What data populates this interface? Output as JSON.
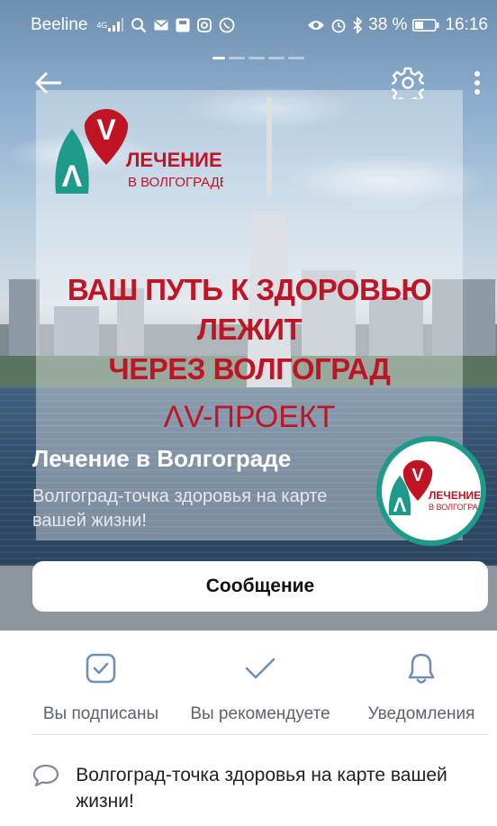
{
  "status_bar": {
    "carrier": "Beeline",
    "network": "4G",
    "battery": "38 %",
    "time": "16:16"
  },
  "pager": {
    "pages": 5,
    "active": 1
  },
  "nav": {
    "back_icon": "arrow-left-icon",
    "settings_icon": "gear-icon",
    "more_icon": "more-vertical-icon"
  },
  "cover": {
    "logo_text_line1": "ЛЕЧЕНИЕ",
    "logo_text_line2": "В ВОЛГОГРАДЕ",
    "headline_lines": [
      "ВАШ ПУТЬ К ЗДОРОВЬЮ",
      "ЛЕЖИТ",
      "ЧЕРЕЗ ВОЛГОГРАД"
    ],
    "subline": "ΛV-ПРОЕКТ"
  },
  "group": {
    "name": "Лечение в Волгограде",
    "status": "Волгоград-точка здоровья на карте вашей жизни!"
  },
  "avatar": {
    "line1": "ЛЕЧЕНИЕ",
    "line2": "В ВОЛГОГРАДЕ"
  },
  "message_button": "Сообщение",
  "actions": [
    {
      "label": "Вы подписаны",
      "icon": "checkbox-checked-icon"
    },
    {
      "label": "Вы рекомендуете",
      "icon": "checkmark-icon"
    },
    {
      "label": "Уведомления",
      "icon": "bell-icon"
    }
  ],
  "info": {
    "status_icon": "speech-bubble-icon",
    "status_text": "Волгоград-точка здоровья на карте вашей жизни!"
  },
  "colors": {
    "brand_red": "#c01424",
    "brand_teal": "#1e9a8a",
    "icon_blue": "#6f8fb3"
  }
}
